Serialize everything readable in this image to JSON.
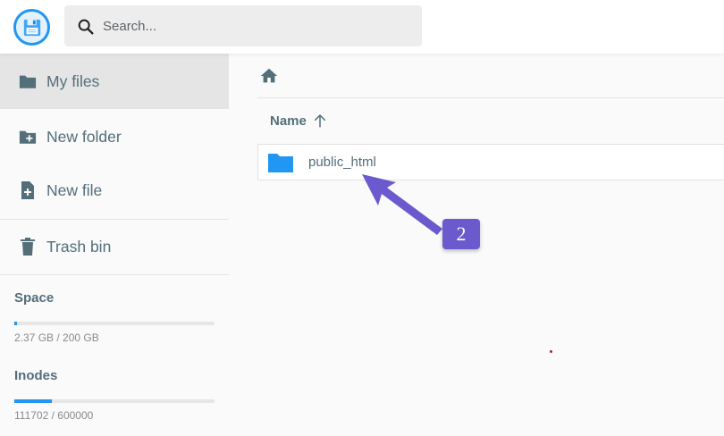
{
  "search": {
    "placeholder": "Search..."
  },
  "sidebar": {
    "items": [
      {
        "label": "My files",
        "icon": "folder-icon"
      },
      {
        "label": "New folder",
        "icon": "new-folder-icon"
      },
      {
        "label": "New file",
        "icon": "new-file-icon"
      },
      {
        "label": "Trash bin",
        "icon": "trash-icon"
      }
    ],
    "space": {
      "title": "Space",
      "usage": "2.37 GB / 200 GB",
      "fraction": 0.012
    },
    "inodes": {
      "title": "Inodes",
      "usage": "111702 / 600000",
      "fraction": 0.186
    }
  },
  "main": {
    "column_header": "Name",
    "files": [
      {
        "name": "public_html",
        "type": "folder"
      }
    ]
  },
  "annotation": {
    "label": "2",
    "color": "#6a5acd"
  },
  "colors": {
    "accent": "#2196f3",
    "text": "#546e7a"
  }
}
